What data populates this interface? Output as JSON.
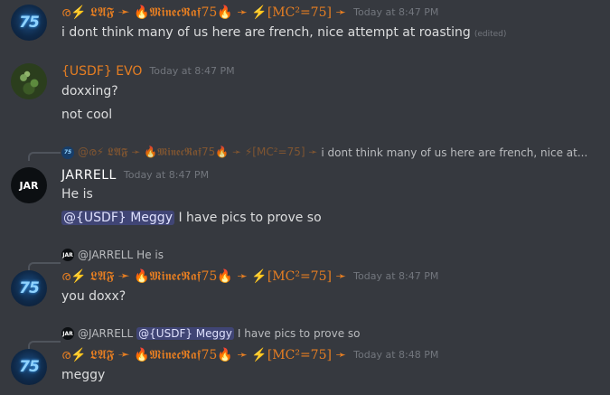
{
  "users": {
    "laf": "ര⚡ 𝕷𝕬𝕱 ➛ 🔥𝕸𝖎𝖓𝖊𝖈𝕽𝖆𝖋75🔥 ➛ ⚡[MC²=75] ➛",
    "usdf": "{USDF} EVO",
    "jar": "JARRELL"
  },
  "avatars": {
    "laf": "75",
    "jar": "JAR"
  },
  "messages": [
    {
      "time": "Today at 8:47 PM",
      "text": "i dont think many of us here are french, nice attempt at roasting",
      "edited": "(edited)"
    },
    {
      "time": "Today at 8:47 PM",
      "lines": [
        "doxxing?",
        "not cool"
      ]
    },
    {
      "reply_user": "@ര⚡ 𝕷𝕬𝕱 ➛ 🔥𝕸𝖎𝖓𝖊𝖈𝕽𝖆𝖋75🔥 ➛ ⚡[MC²=75] ➛",
      "reply_text": "i dont think many of us here are french, nice at...",
      "time": "Today at 8:47 PM",
      "line1": "He is",
      "mention": "@{USDF} Meggy",
      "line2": "I have pics to prove so"
    },
    {
      "reply_user": "@JARRELL",
      "reply_text": "He is",
      "time": "Today at 8:47 PM",
      "text": "you doxx?"
    },
    {
      "reply_user": "@JARRELL",
      "reply_mention": "@{USDF} Meggy",
      "reply_text": "I have pics to prove so",
      "time": "Today at 8:48 PM",
      "text": "meggy"
    }
  ]
}
